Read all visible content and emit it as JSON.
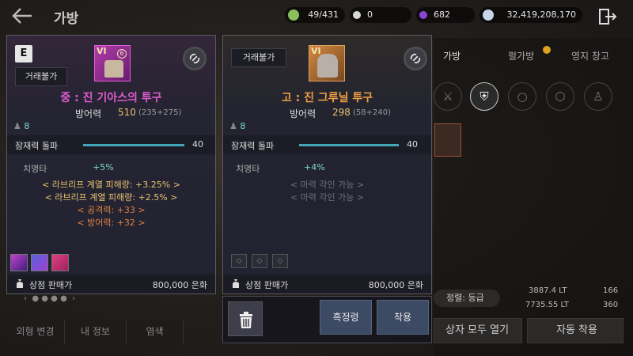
{
  "header": {
    "title": "가방",
    "resources": [
      {
        "name": "weight-resource",
        "value": "49/431",
        "color": "#8cbf5c"
      },
      {
        "name": "pearl-resource",
        "value": "0",
        "color": "#d8d8d8"
      },
      {
        "name": "crystal-resource",
        "value": "682",
        "color": "#8c44d4"
      },
      {
        "name": "silver-resource",
        "value": "32,419,208,170",
        "color": "#c8d4e8"
      }
    ]
  },
  "background_panel": {
    "tabs": [
      "가방",
      "펄가방",
      "영지 창고"
    ],
    "sort_label": "정렬: 등급",
    "weight_top": "3887.4 LT",
    "weight_bottom": "7735.55 LT",
    "count_top": "166",
    "count_bottom": "360",
    "open_all_label": "상자 모두 열기",
    "auto_equip_label": "자동 착용",
    "bottom_tabs": [
      "외형 변경",
      "내 정보",
      "염색"
    ]
  },
  "left_card": {
    "grade": "E",
    "trade_tag": "거래불가",
    "enhance_label": "VI",
    "name": "중 : 진 기아스의 투구",
    "name_color": "#e05cd0",
    "stat_label": "방어력",
    "stat_value": "510",
    "stat_breakdown": "(235+275)",
    "weight": "8",
    "potential_label": "잠재력 돌파",
    "potential_value": "40",
    "sub_stat_label": "치명타",
    "sub_stat_value": "+5%",
    "lines": [
      {
        "text": "< 라브리프 계열 피해량: +3.25% >",
        "color": "#e8c070"
      },
      {
        "text": "< 라브리프 계열 피해량: +2.5% >",
        "color": "#e8c070"
      },
      {
        "text": "< 공격력: +33 >",
        "color": "#e08040"
      },
      {
        "text": "< 방어력: +32 >",
        "color": "#e08040"
      }
    ],
    "price_label": "상점 판매가",
    "price_value": "800,000 은화"
  },
  "right_card": {
    "trade_tag": "거래불가",
    "enhance_label": "VI",
    "name": "고 : 진 그루닐 투구",
    "name_color": "#f0a040",
    "stat_label": "방어력",
    "stat_value": "298",
    "stat_breakdown": "(58+240)",
    "weight": "8",
    "potential_label": "잠재력 돌파",
    "potential_value": "40",
    "sub_stat_label": "치명타",
    "sub_stat_value": "+4%",
    "lines": [
      {
        "text": "< 마력 각인 가능 >",
        "color": "#707078"
      },
      {
        "text": "< 마력 각인 가능 >",
        "color": "#707078"
      }
    ],
    "price_label": "상점 판매가",
    "price_value": "800,000 은화"
  },
  "actions": {
    "black_spirit_label": "흑정령",
    "equip_label": "착용"
  }
}
